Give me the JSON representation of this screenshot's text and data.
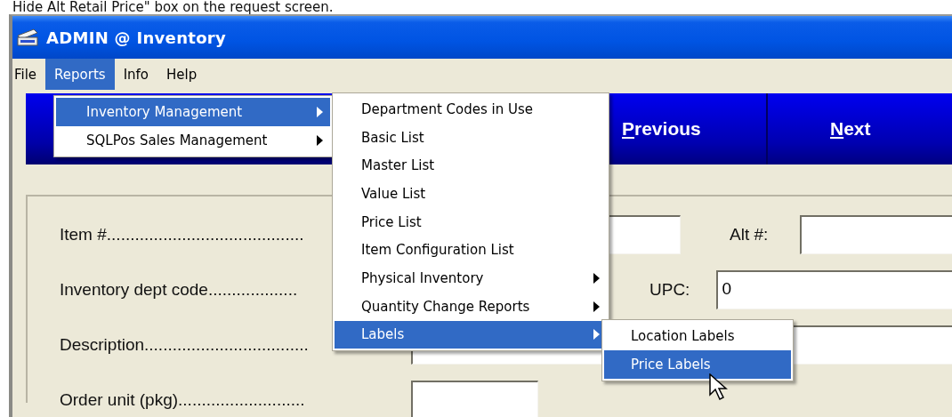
{
  "caption": "Hide Alt Retail Price\" box on the request screen.",
  "window": {
    "title": "ADMIN @ Inventory"
  },
  "menu_bar": [
    {
      "label": "File",
      "selected": false
    },
    {
      "label": "Reports",
      "selected": true
    },
    {
      "label": "Info",
      "selected": false
    },
    {
      "label": "Help",
      "selected": false
    }
  ],
  "reports_menu": [
    {
      "label": "Inventory Management",
      "selected": true,
      "submenu": true
    },
    {
      "label": "SQLPos Sales Management",
      "selected": false,
      "submenu": true
    }
  ],
  "inventory_menu": [
    {
      "label": "Department Codes in Use",
      "selected": false,
      "submenu": false
    },
    {
      "label": "Basic List",
      "selected": false,
      "submenu": false
    },
    {
      "label": "Master List",
      "selected": false,
      "submenu": false
    },
    {
      "label": "Value List",
      "selected": false,
      "submenu": false
    },
    {
      "label": "Price List",
      "selected": false,
      "submenu": false
    },
    {
      "label": "Item Configuration List",
      "selected": false,
      "submenu": false
    },
    {
      "label": "Physical Inventory",
      "selected": false,
      "submenu": true
    },
    {
      "label": "Quantity Change Reports",
      "selected": false,
      "submenu": true
    },
    {
      "label": "Labels",
      "selected": true,
      "submenu": true
    }
  ],
  "labels_menu": [
    {
      "label": "Location Labels",
      "selected": false,
      "submenu": false
    },
    {
      "label": "Price Labels",
      "selected": true,
      "submenu": false
    }
  ],
  "toolbar": [
    {
      "access_key": "P",
      "rest": "revious"
    },
    {
      "access_key": "N",
      "rest": "ext"
    }
  ],
  "form": {
    "item_label": "Item #..........................................",
    "alt_label": "Alt #:",
    "dept_label": "Inventory dept code...................",
    "upc_label": "UPC:",
    "upc_value": "0",
    "description_label": "Description...................................",
    "order_unit_label": "Order unit (pkg)..........................."
  }
}
